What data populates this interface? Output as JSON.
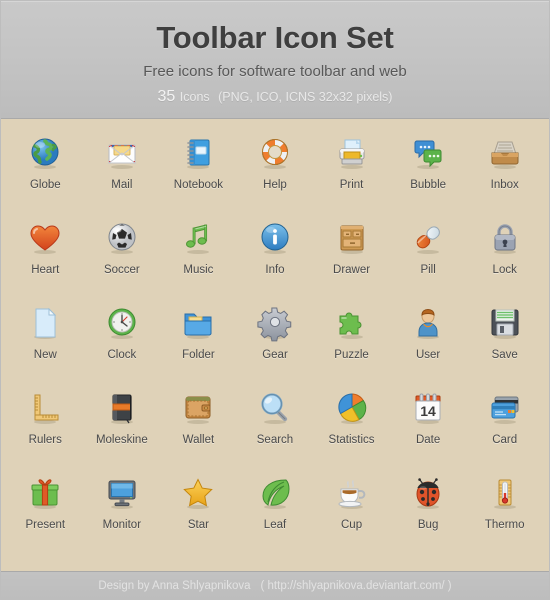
{
  "header": {
    "title": "Toolbar Icon Set",
    "subtitle": "Free icons for software toolbar and web",
    "count": "35",
    "unit": "Icons",
    "formats": "(PNG, ICO, ICNS 32x32 pixels)"
  },
  "footer": {
    "credit": "Design by Anna Shlyapnikova",
    "url": "( http://shlyapnikova.deviantart.com/ )"
  },
  "colors": {
    "page_background": "#dfd2b8",
    "header_background": "#c4c4c4",
    "footer_background": "#bfbfbf",
    "title_text": "#3f3f3f",
    "label_text": "#4a4a4a"
  },
  "icons": [
    {
      "label": "Globe",
      "icon": "globe-icon"
    },
    {
      "label": "Mail",
      "icon": "mail-icon"
    },
    {
      "label": "Notebook",
      "icon": "notebook-icon"
    },
    {
      "label": "Help",
      "icon": "help-lifebuoy-icon"
    },
    {
      "label": "Print",
      "icon": "print-icon"
    },
    {
      "label": "Bubble",
      "icon": "speech-bubble-icon"
    },
    {
      "label": "Inbox",
      "icon": "inbox-icon"
    },
    {
      "label": "Heart",
      "icon": "heart-icon"
    },
    {
      "label": "Soccer",
      "icon": "soccer-ball-icon"
    },
    {
      "label": "Music",
      "icon": "music-note-icon"
    },
    {
      "label": "Info",
      "icon": "info-icon"
    },
    {
      "label": "Drawer",
      "icon": "drawer-icon"
    },
    {
      "label": "Pill",
      "icon": "pill-icon"
    },
    {
      "label": "Lock",
      "icon": "lock-icon"
    },
    {
      "label": "New",
      "icon": "new-document-icon"
    },
    {
      "label": "Clock",
      "icon": "clock-icon"
    },
    {
      "label": "Folder",
      "icon": "folder-icon"
    },
    {
      "label": "Gear",
      "icon": "gear-icon"
    },
    {
      "label": "Puzzle",
      "icon": "puzzle-piece-icon"
    },
    {
      "label": "User",
      "icon": "user-icon"
    },
    {
      "label": "Save",
      "icon": "save-floppy-icon"
    },
    {
      "label": "Rulers",
      "icon": "rulers-icon"
    },
    {
      "label": "Moleskine",
      "icon": "moleskine-notebook-icon"
    },
    {
      "label": "Wallet",
      "icon": "wallet-icon"
    },
    {
      "label": "Search",
      "icon": "search-magnifier-icon"
    },
    {
      "label": "Statistics",
      "icon": "statistics-pie-chart-icon"
    },
    {
      "label": "Date",
      "icon": "calendar-date-icon"
    },
    {
      "label": "Card",
      "icon": "credit-card-icon"
    },
    {
      "label": "Present",
      "icon": "present-gift-icon"
    },
    {
      "label": "Monitor",
      "icon": "monitor-icon"
    },
    {
      "label": "Star",
      "icon": "star-icon"
    },
    {
      "label": "Leaf",
      "icon": "leaf-icon"
    },
    {
      "label": "Cup",
      "icon": "coffee-cup-icon"
    },
    {
      "label": "Bug",
      "icon": "ladybug-icon"
    },
    {
      "label": "Thermo",
      "icon": "thermometer-icon"
    }
  ],
  "calendar_day": "14"
}
